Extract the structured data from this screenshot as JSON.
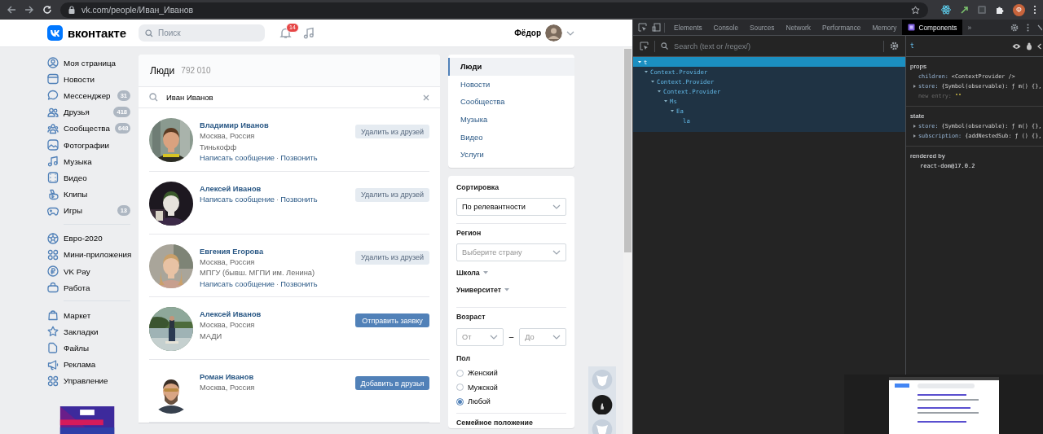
{
  "browser": {
    "url": "vk.com/people/Иван_Иванов",
    "profile_initial": "Ф"
  },
  "header": {
    "logo_text": "вконтакте",
    "search_placeholder": "Поиск",
    "notifications_count": "14",
    "user_name": "Фёдор"
  },
  "sidebar": {
    "groups": [
      {
        "items": [
          {
            "label": "Моя страница"
          },
          {
            "label": "Новости"
          },
          {
            "label": "Мессенджер",
            "count": "31"
          },
          {
            "label": "Друзья",
            "count": "418"
          },
          {
            "label": "Сообщества",
            "count": "648"
          },
          {
            "label": "Фотографии"
          },
          {
            "label": "Музыка"
          },
          {
            "label": "Видео"
          },
          {
            "label": "Клипы"
          },
          {
            "label": "Игры",
            "count": "13"
          }
        ]
      },
      {
        "items": [
          {
            "label": "Евро-2020"
          },
          {
            "label": "Мини-приложения"
          },
          {
            "label": "VK Pay"
          },
          {
            "label": "Работа"
          }
        ]
      },
      {
        "items": [
          {
            "label": "Маркет"
          },
          {
            "label": "Закладки"
          },
          {
            "label": "Файлы"
          },
          {
            "label": "Реклама"
          },
          {
            "label": "Управление"
          }
        ]
      }
    ]
  },
  "people": {
    "title": "Люди",
    "count": "792 010",
    "search_value": "Иван Иванов",
    "results": [
      {
        "name": "Владимир Иванов",
        "lines": [
          "Москва, Россия",
          "Тинькофф"
        ],
        "links": [
          "Написать сообщение",
          "Позвонить"
        ],
        "action": {
          "label": "Удалить из друзей",
          "kind": "secondary"
        }
      },
      {
        "name": "Алексей Иванов",
        "links": [
          "Написать сообщение",
          "Позвонить"
        ],
        "action": {
          "label": "Удалить из друзей",
          "kind": "secondary"
        }
      },
      {
        "name": "Евгения Егорова",
        "lines": [
          "Москва, Россия",
          "МПГУ (бывш. МГПИ им. Ленина)"
        ],
        "links": [
          "Написать сообщение",
          "Позвонить"
        ],
        "action": {
          "label": "Удалить из друзей",
          "kind": "secondary"
        }
      },
      {
        "name": "Алексей Иванов",
        "lines": [
          "Москва, Россия",
          "МАДИ"
        ],
        "action": {
          "label": "Отправить заявку",
          "kind": "primary"
        }
      },
      {
        "name": "Роман Иванов",
        "lines": [
          "Москва, Россия"
        ],
        "action": {
          "label": "Добавить в друзья",
          "kind": "primary"
        }
      }
    ],
    "link_separator": "·"
  },
  "search_sections": [
    {
      "label": "Люди",
      "selected": true
    },
    {
      "label": "Новости",
      "selected": false
    },
    {
      "label": "Сообщества",
      "selected": false
    },
    {
      "label": "Музыка",
      "selected": false
    },
    {
      "label": "Видео",
      "selected": false
    },
    {
      "label": "Услуги",
      "selected": false
    }
  ],
  "filters": {
    "sort_label": "Сортировка",
    "sort_value": "По релевантности",
    "region_label": "Регион",
    "region_placeholder": "Выберите страну",
    "school_label": "Школа",
    "university_label": "Университет",
    "age_label": "Возраст",
    "age_from_placeholder": "От",
    "age_dash": "–",
    "age_to_placeholder": "До",
    "gender_label": "Пол",
    "gender_options": [
      {
        "label": "Женский",
        "selected": false
      },
      {
        "label": "Мужской",
        "selected": false
      },
      {
        "label": "Любой",
        "selected": true
      }
    ],
    "marital_label": "Семейное положение"
  },
  "devtools": {
    "tabs": [
      {
        "label": "Elements",
        "selected": false
      },
      {
        "label": "Console",
        "selected": false
      },
      {
        "label": "Sources",
        "selected": false
      },
      {
        "label": "Network",
        "selected": false
      },
      {
        "label": "Performance",
        "selected": false
      },
      {
        "label": "Memory",
        "selected": false
      },
      {
        "label": "Components",
        "selected": true
      }
    ],
    "more_tabs": "»",
    "search_placeholder": "Search (text or /regex/)",
    "tree": [
      {
        "name": "t",
        "selected": true,
        "expanded": true,
        "children": [
          {
            "name": "Context.Provider",
            "selected": false,
            "expanded": true,
            "children": [
              {
                "name": "Context.Provider",
                "selected": false,
                "expanded": true,
                "children": [
                  {
                    "name": "Context.Provider",
                    "selected": false,
                    "expanded": true,
                    "children": [
                      {
                        "name": "Ms",
                        "selected": false,
                        "expanded": true,
                        "children": [
                          {
                            "name": "Ea",
                            "selected": false,
                            "expanded": true,
                            "children": [
                              {
                                "name": "la",
                                "selected": false
                              }
                            ]
                          }
                        ]
                      }
                    ]
                  }
                ]
              }
            ]
          }
        ]
      }
    ],
    "inspected_name": "t",
    "sections": [
      {
        "title": "props",
        "entries": [
          {
            "key": "children:",
            "value": "<ContextProvider />",
            "kind": "field",
            "expandable": false
          },
          {
            "key": "store:",
            "value": "{Symbol(observable): ƒ m() {},",
            "kind": "field",
            "expandable": true
          },
          {
            "key": "new entry:",
            "value": "\"\"",
            "kind": "new-entry",
            "expandable": false
          }
        ]
      },
      {
        "title": "state",
        "entries": [
          {
            "key": "store:",
            "value": "{Symbol(observable): ƒ m() {},",
            "kind": "field",
            "expandable": true
          },
          {
            "key": "subscription:",
            "value": "{addNestedSub: ƒ () {},",
            "kind": "field",
            "expandable": true
          }
        ]
      }
    ],
    "rendered_by_label": "rendered by",
    "rendered_by": "react-dom@17.0.2"
  }
}
